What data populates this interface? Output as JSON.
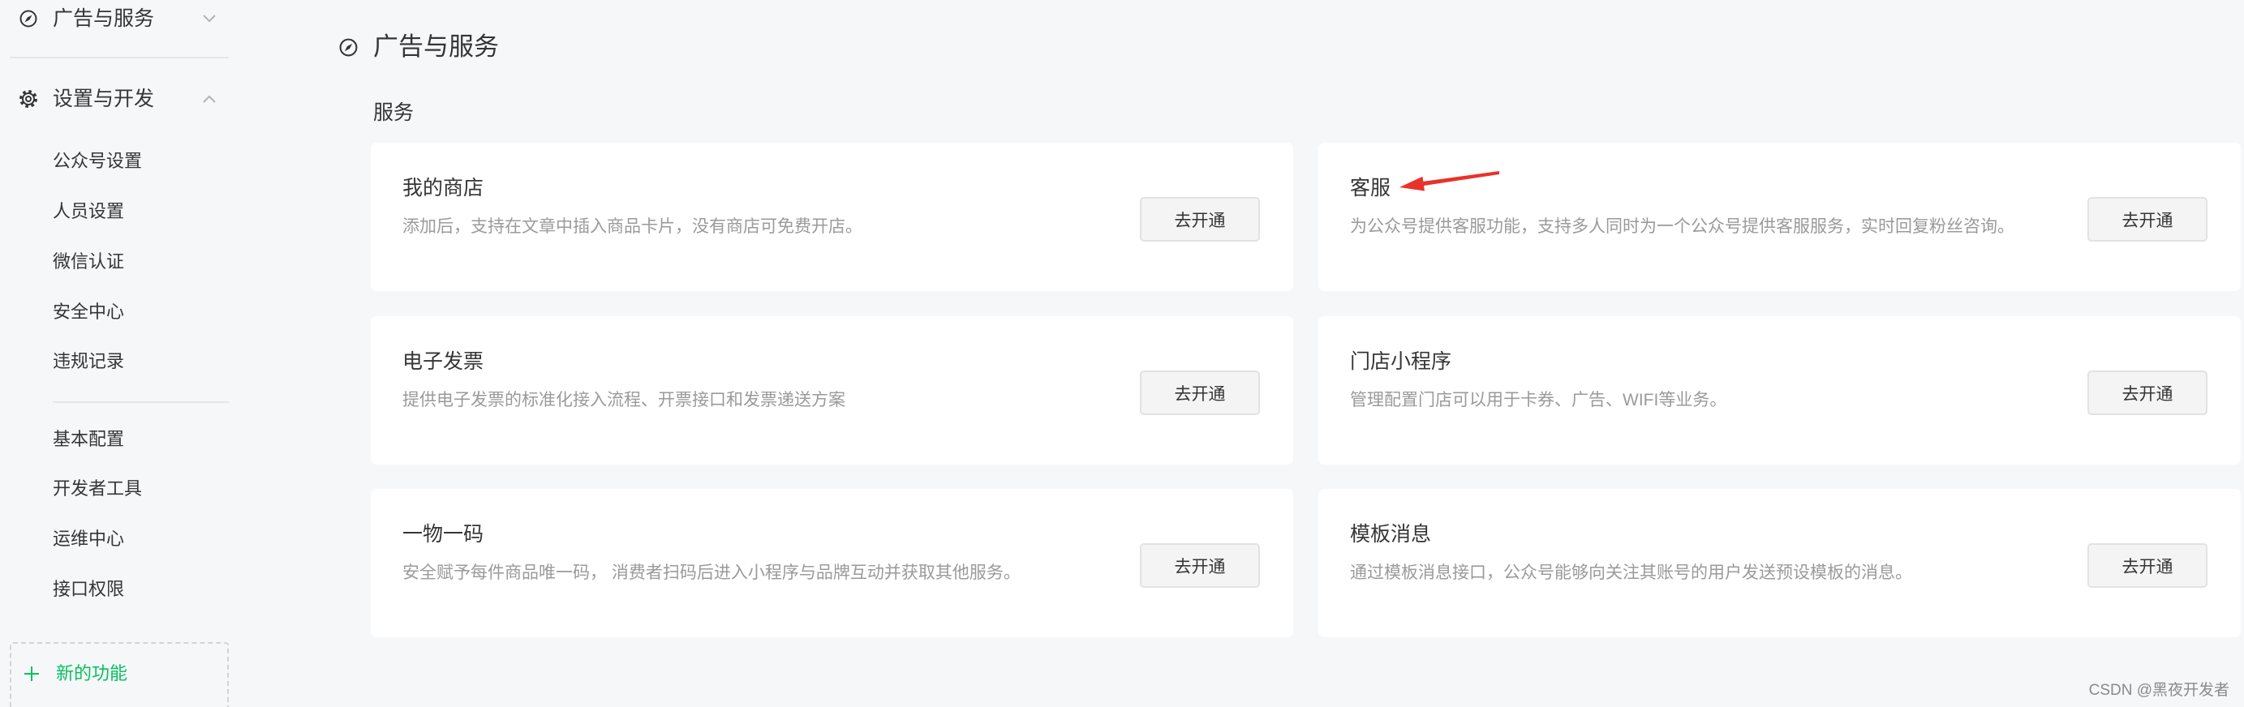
{
  "sidebar": {
    "ad_service": {
      "label": "广告与服务",
      "icon": "compass-icon",
      "chevron": "chevron-down-icon"
    },
    "settings_dev": {
      "label": "设置与开发",
      "icon": "gear-icon",
      "chevron": "chevron-up-icon"
    },
    "account_items": [
      "公众号设置",
      "人员设置",
      "微信认证",
      "安全中心",
      "违规记录"
    ],
    "dev_items": [
      "基本配置",
      "开发者工具",
      "运维中心",
      "接口权限"
    ],
    "new_feature": {
      "label": "新的功能",
      "icon": "plus-icon"
    }
  },
  "main": {
    "title": "广告与服务",
    "title_icon": "compass-icon",
    "section_title": "服务",
    "cards": [
      {
        "title": "我的商店",
        "desc": "添加后，支持在文章中插入商品卡片，没有商店可免费开店。",
        "button": "去开通"
      },
      {
        "title": "客服",
        "desc": "为公众号提供客服功能，支持多人同时为一个公众号提供客服服务，实时回复粉丝咨询。",
        "button": "去开通"
      },
      {
        "title": "电子发票",
        "desc": "提供电子发票的标准化接入流程、开票接口和发票递送方案",
        "button": "去开通"
      },
      {
        "title": "门店小程序",
        "desc": "管理配置门店可以用于卡券、广告、WIFI等业务。",
        "button": "去开通"
      },
      {
        "title": "一物一码",
        "desc": "安全赋予每件商品唯一码， 消费者扫码后进入小程序与品牌互动并获取其他服务。",
        "button": "去开通"
      },
      {
        "title": "模板消息",
        "desc": "通过模板消息接口，公众号能够向关注其账号的用户发送预设模板的消息。",
        "button": "去开通"
      }
    ]
  },
  "annotation": {
    "icon": "red-arrow-icon",
    "color": "#e8322a"
  },
  "watermark": "CSDN @黑夜开发者",
  "colors": {
    "accent": "#07c160",
    "background": "#f6f7f9",
    "card": "#ffffff",
    "text": "#353535",
    "muted": "#9a9a9a"
  }
}
